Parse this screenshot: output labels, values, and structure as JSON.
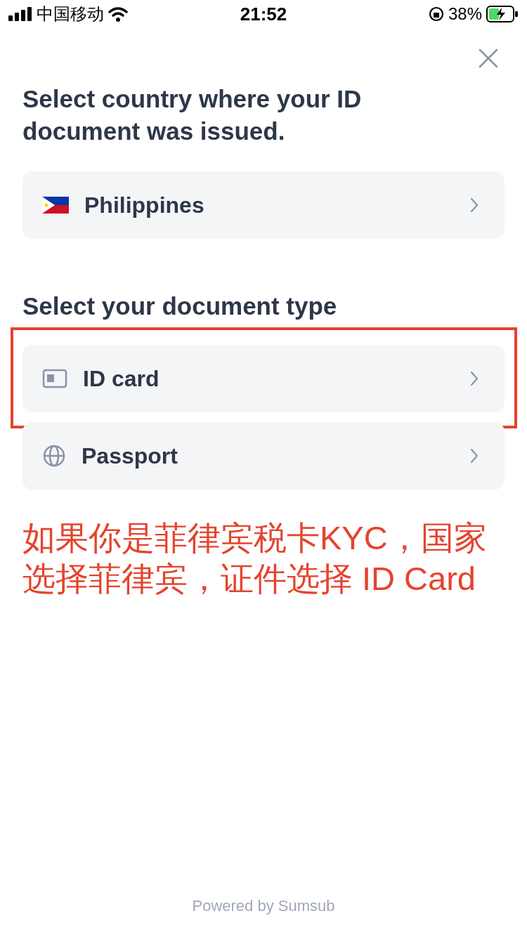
{
  "status_bar": {
    "carrier": "中国移动",
    "time": "21:52",
    "battery": "38%"
  },
  "title": "Select country where your ID document was issued.",
  "country": {
    "name": "Philippines"
  },
  "document_title": "Select your document type",
  "documents": [
    {
      "label": "ID card",
      "kind": "id",
      "highlighted": true
    },
    {
      "label": "Passport",
      "kind": "passport",
      "highlighted": false
    }
  ],
  "annotation": [
    "如果你是菲律宾税卡KYC，国家",
    "选择菲律宾，证件选择 ID Card"
  ],
  "footer": "Powered by Sumsub"
}
